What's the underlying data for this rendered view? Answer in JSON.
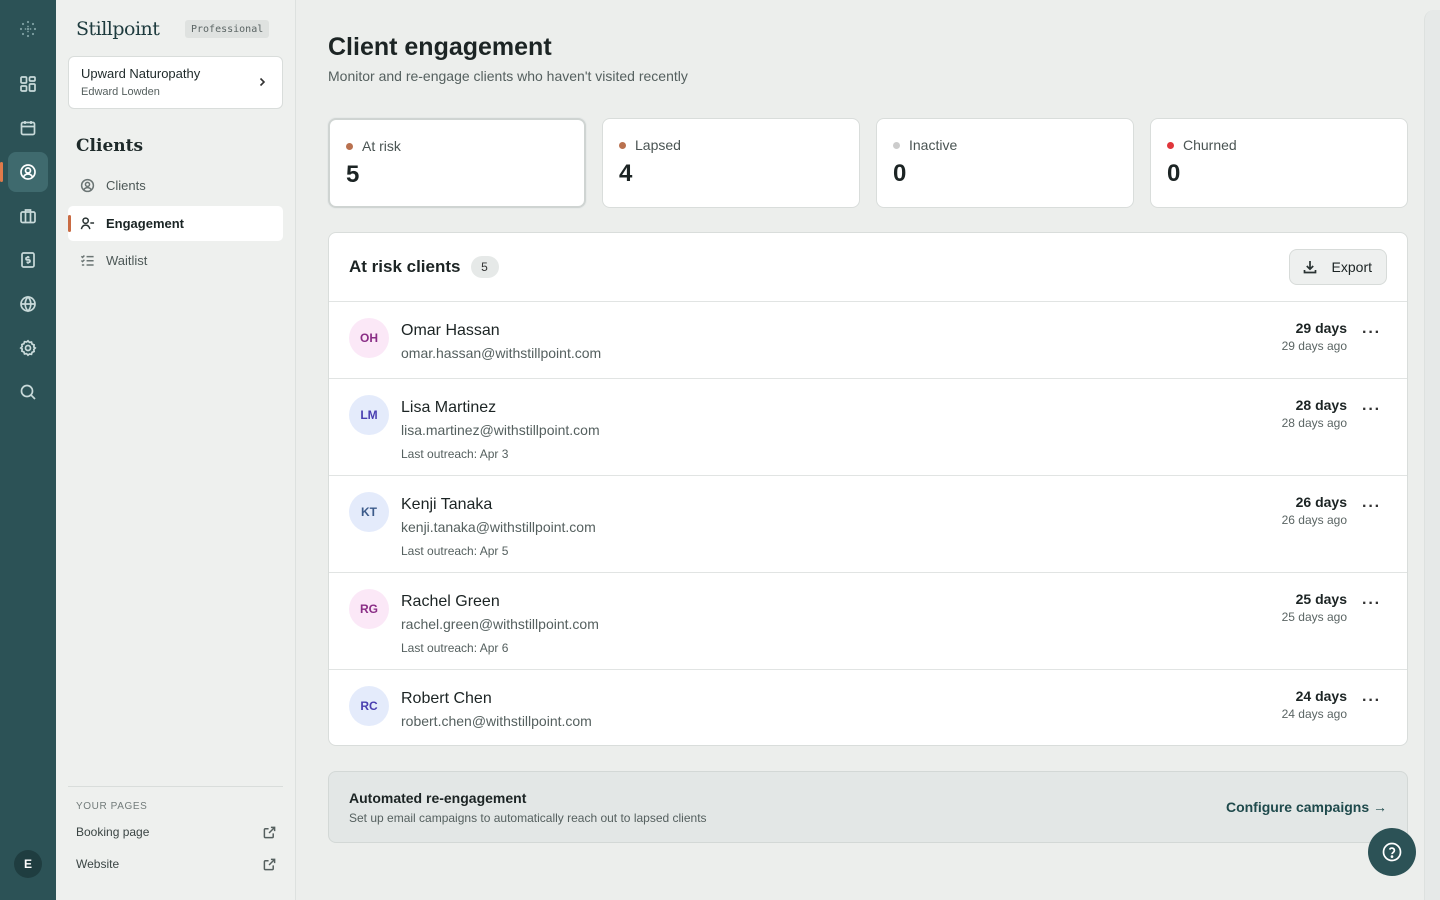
{
  "sidebar": {
    "brand": "Stillpoint",
    "plan": "Professional",
    "org": {
      "name": "Upward Naturopathy",
      "user": "Edward Lowden"
    },
    "section_title": "Clients",
    "nav": [
      {
        "label": "Clients",
        "icon": "user-circle-icon",
        "active": false
      },
      {
        "label": "Engagement",
        "icon": "user-minus-icon",
        "active": true
      },
      {
        "label": "Waitlist",
        "icon": "list-check-icon",
        "active": false
      }
    ],
    "pages_title": "YOUR PAGES",
    "pages": [
      {
        "label": "Booking page",
        "icon": "external-link-icon"
      },
      {
        "label": "Website",
        "icon": "external-link-icon"
      }
    ],
    "avatar_initial": "E"
  },
  "main": {
    "title": "Client engagement",
    "subtitle": "Monitor and re-engage clients who haven't visited recently",
    "stats": [
      {
        "label": "At risk",
        "value": "5",
        "color": "#b9714f",
        "selected": true
      },
      {
        "label": "Lapsed",
        "value": "4",
        "color": "#b9714f",
        "selected": false
      },
      {
        "label": "Inactive",
        "value": "0",
        "color": "#cccccc",
        "selected": false
      },
      {
        "label": "Churned",
        "value": "0",
        "color": "#e0363b",
        "selected": false
      }
    ],
    "list": {
      "title": "At risk clients",
      "count": "5",
      "export_label": "Export",
      "rows": [
        {
          "initials": "OH",
          "name": "Omar Hassan",
          "email": "omar.hassan@withstillpoint.com",
          "outreach": "",
          "days": "29 days",
          "ago": "29 days ago",
          "avatar_bg": "#fbe8f7",
          "avatar_fg": "#8a2e86"
        },
        {
          "initials": "LM",
          "name": "Lisa Martinez",
          "email": "lisa.martinez@withstillpoint.com",
          "outreach": "Last outreach: Apr 3",
          "days": "28 days",
          "ago": "28 days ago",
          "avatar_bg": "#e4ebfb",
          "avatar_fg": "#4a3fb0"
        },
        {
          "initials": "KT",
          "name": "Kenji Tanaka",
          "email": "kenji.tanaka@withstillpoint.com",
          "outreach": "Last outreach: Apr 5",
          "days": "26 days",
          "ago": "26 days ago",
          "avatar_bg": "#e4ebfb",
          "avatar_fg": "#3c5b8a"
        },
        {
          "initials": "RG",
          "name": "Rachel Green",
          "email": "rachel.green@withstillpoint.com",
          "outreach": "Last outreach: Apr 6",
          "days": "25 days",
          "ago": "25 days ago",
          "avatar_bg": "#fbe8f7",
          "avatar_fg": "#8a2e86"
        },
        {
          "initials": "RC",
          "name": "Robert Chen",
          "email": "robert.chen@withstillpoint.com",
          "outreach": "",
          "days": "24 days",
          "ago": "24 days ago",
          "avatar_bg": "#e4ebfb",
          "avatar_fg": "#4a3fb0"
        }
      ]
    },
    "banner": {
      "title": "Automated re-engagement",
      "subtitle": "Set up email campaigns to automatically reach out to lapsed clients",
      "link": "Configure campaigns →"
    }
  }
}
